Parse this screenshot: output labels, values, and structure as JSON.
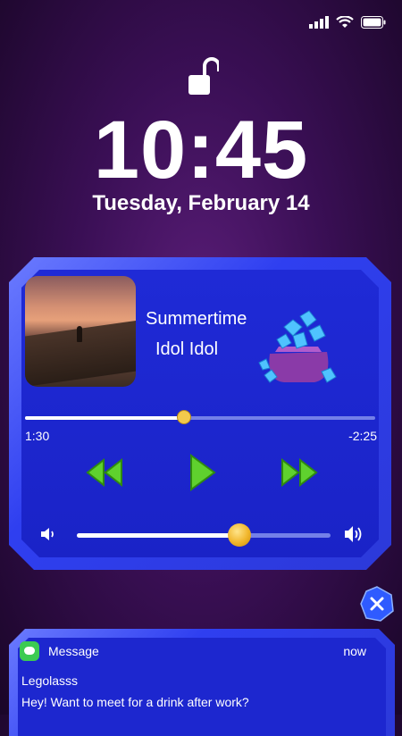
{
  "status_bar": {
    "signal_icon": "signal-icon",
    "wifi_icon": "wifi-icon",
    "battery_icon": "battery-icon"
  },
  "lock_icon": "unlocked-padlock-icon",
  "clock": {
    "time": "10:45",
    "date": "Tuesday, February 14"
  },
  "player": {
    "song_title": "Summertime",
    "artist": "Idol Idol",
    "elapsed": "1:30",
    "remaining": "-2:25",
    "progress_fraction": 0.455,
    "volume_fraction": 0.64,
    "accent_color": "#2f3ff0",
    "knob_color": "#f2c94c",
    "controls": {
      "rewind_icon": "rewind-icon",
      "play_icon": "play-icon",
      "forward_icon": "fast-forward-icon"
    },
    "volume_low_icon": "volume-low-icon",
    "volume_high_icon": "volume-high-icon"
  },
  "close_icon": "close-icon",
  "notification": {
    "app": "Message",
    "time": "now",
    "sender": "Legolasss",
    "text": "Hey! Want to meet for a drink after work?",
    "app_icon": "message-icon"
  }
}
